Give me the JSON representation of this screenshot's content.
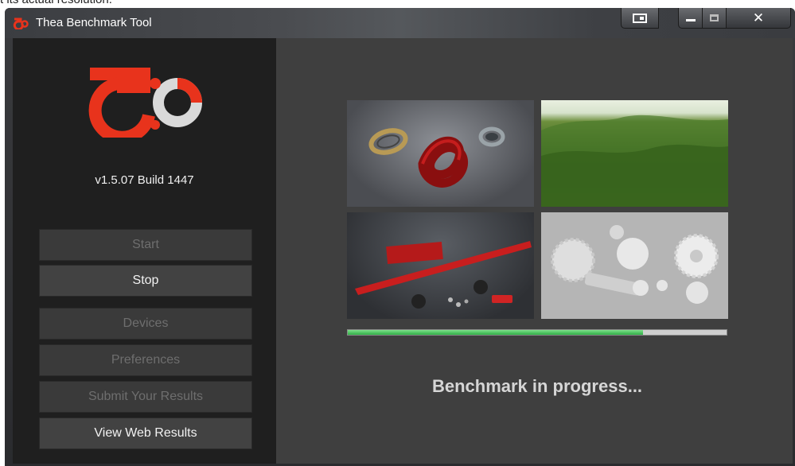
{
  "window": {
    "title": "Thea Benchmark Tool"
  },
  "clipped_top_text": "t its actual resolution.",
  "app": {
    "version": "v1.5.07 Build 1447",
    "buttons": {
      "start": "Start",
      "stop": "Stop",
      "devices": "Devices",
      "preferences": "Preferences",
      "submit": "Submit Your Results",
      "web_results": "View Web Results"
    },
    "status_text": "Benchmark in progress...",
    "progress_fraction": 0.78
  },
  "colors": {
    "brand_red": "#e8331c",
    "progress_green": "#3cc24f"
  },
  "icons": {
    "app": "thea-logo-icon",
    "snap": "snap-icon",
    "minimize": "minimize-icon",
    "maximize": "maximize-icon",
    "close": "close-icon"
  }
}
